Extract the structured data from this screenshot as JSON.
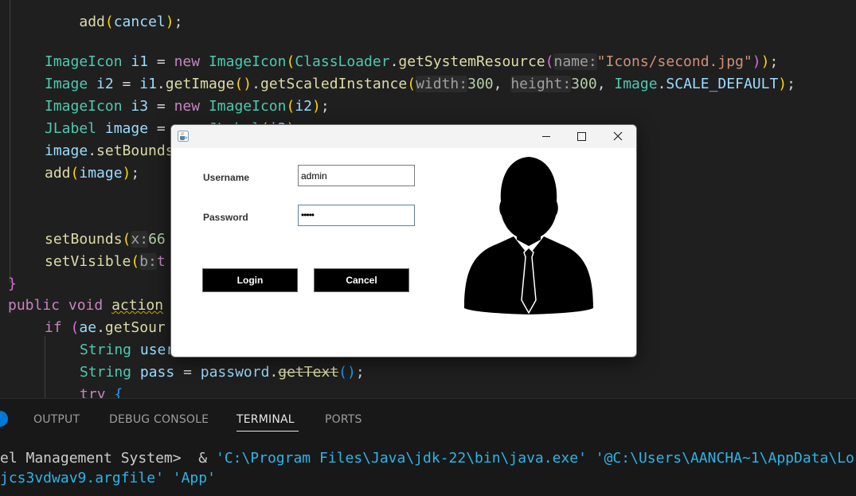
{
  "editor": {
    "lines": [
      "add(cancel);",
      "ImageIcon i1 = new ImageIcon(ClassLoader.getSystemResource(name:\"Icons/second.jpg\"));",
      "Image i2 = i1.getImage().getScaledInstance(width:300, height:300, Image.SCALE_DEFAULT);",
      "ImageIcon i3 = new ImageIcon(i2);",
      "JLabel image = new JLabel(i3);",
      "image.setBounds(",
      "add(image);",
      "setBounds(x:66",
      "setVisible(b:t",
      "}",
      "public void action",
      "if (ae.getSour",
      "String user = username.getText();",
      "String pass = password.getText();",
      "try {"
    ]
  },
  "panel": {
    "tabs": [
      "OUTPUT",
      "DEBUG CONSOLE",
      "TERMINAL",
      "PORTS"
    ],
    "active_tab": "TERMINAL",
    "terminal_line1_prompt": "el Management System>  & ",
    "terminal_line1_str": "'C:\\Program Files\\Java\\jdk-22\\bin\\java.exe' '@C:\\Users\\AANCHA~1\\AppData\\Lo",
    "terminal_line2": "jcs3vdwav9.argfile' 'App'"
  },
  "dialog": {
    "icons": {
      "app": "java-cup-icon",
      "minimize": "minimize-icon",
      "maximize": "maximize-icon",
      "close": "close-icon",
      "avatar": "user-suit-icon"
    },
    "username_label": "Username",
    "username_value": "admin",
    "password_label": "Password",
    "password_value": "•••••",
    "login_label": "Login",
    "cancel_label": "Cancel"
  }
}
